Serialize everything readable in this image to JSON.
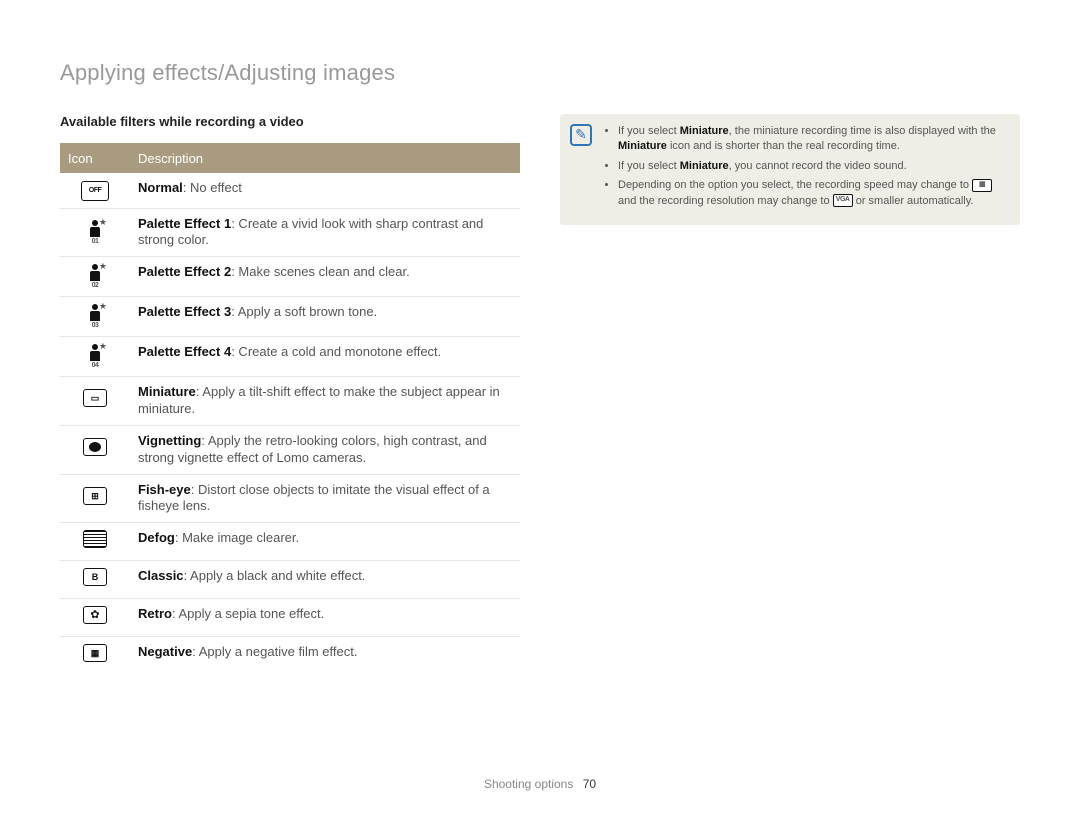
{
  "title": "Applying effects/Adjusting images",
  "subhead": "Available filters while recording a video",
  "table": {
    "header": {
      "icon": "Icon",
      "desc": "Description"
    },
    "rows": [
      {
        "icon_name": "normal-off-icon",
        "label": "Normal",
        "text": ": No effect"
      },
      {
        "icon_name": "palette-1-icon",
        "label": "Palette Effect 1",
        "text": ": Create a vivid look with sharp contrast and strong color."
      },
      {
        "icon_name": "palette-2-icon",
        "label": "Palette Effect 2",
        "text": ": Make scenes clean and clear."
      },
      {
        "icon_name": "palette-3-icon",
        "label": "Palette Effect 3",
        "text": ": Apply a soft brown tone."
      },
      {
        "icon_name": "palette-4-icon",
        "label": "Palette Effect 4",
        "text": ": Create a cold and monotone effect."
      },
      {
        "icon_name": "miniature-icon",
        "label": "Miniature",
        "text": ": Apply a tilt-shift effect to make the subject appear in miniature."
      },
      {
        "icon_name": "vignetting-icon",
        "label": "Vignetting",
        "text": ": Apply the retro-looking colors, high contrast, and strong vignette effect of Lomo cameras."
      },
      {
        "icon_name": "fisheye-icon",
        "label": "Fish-eye",
        "text": ": Distort close objects to imitate the visual effect of a fisheye lens."
      },
      {
        "icon_name": "defog-icon",
        "label": "Defog",
        "text": ": Make image clearer."
      },
      {
        "icon_name": "classic-icon",
        "label": "Classic",
        "text": ": Apply a black and white effect."
      },
      {
        "icon_name": "retro-icon",
        "label": "Retro",
        "text": ": Apply a sepia tone effect."
      },
      {
        "icon_name": "negative-icon",
        "label": "Negative",
        "text": ": Apply a negative film effect."
      }
    ]
  },
  "note": {
    "items": [
      {
        "pre": "If you select ",
        "bold1": "Miniature",
        "mid": ", the miniature recording time is also displayed with the ",
        "bold2": "Miniature",
        "post": " icon and is shorter than the real recording time."
      },
      {
        "pre": "If you select ",
        "bold1": "Miniature",
        "post": ", you cannot record the video sound."
      },
      {
        "pre": "Depending on the option you select, the recording speed may change to ",
        "ico1_label": "res-icon-1",
        "mid": " and the recording resolution may change to ",
        "ico2_text": "VGA",
        "post": " or smaller automatically."
      }
    ]
  },
  "footer": {
    "section": "Shooting options",
    "page": "70"
  }
}
